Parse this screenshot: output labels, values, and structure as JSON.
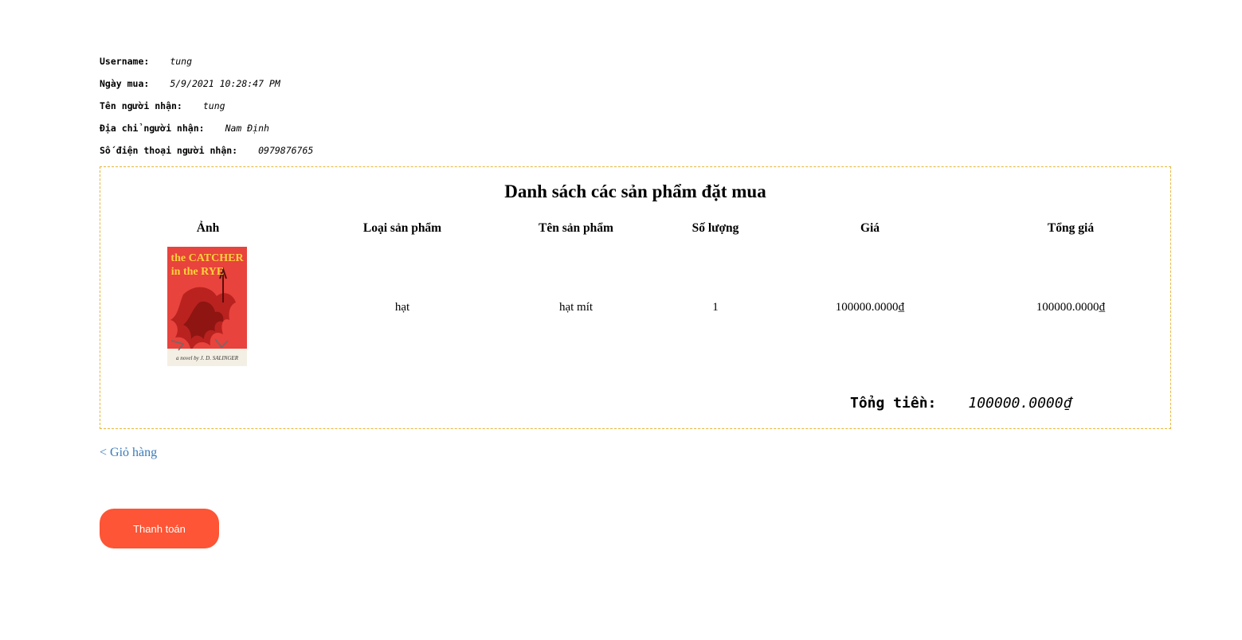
{
  "customer": {
    "username_label": "Username:",
    "username": "tung",
    "date_label": "Ngày mua:",
    "date": "5/9/2021 10:28:47 PM",
    "recipient_label": "Tên người nhận:",
    "recipient": "tung",
    "address_label": "Địa chỉ người nhận:",
    "address": "Nam Định",
    "phone_label": "Số điện thoại người nhận:",
    "phone": "0979876765"
  },
  "order": {
    "title": "Danh sách các sản phẩm đặt mua",
    "columns": [
      "Ảnh",
      "Loại sản phẩm",
      "Tên sản phẩm",
      "Số lượng",
      "Giá",
      "Tổng giá"
    ],
    "rows": [
      {
        "image": {
          "icon": "book-cover-image",
          "title_line1": "the CATCHER",
          "title_line2": "in the RYE",
          "byline": "a novel by J. D. SALINGER"
        },
        "category": "hạt",
        "name": "hạt mít",
        "quantity": "1",
        "price": "100000.0000₫",
        "subtotal": "100000.0000₫"
      }
    ],
    "total_label": "Tổng tiền:",
    "total_value": "100000.0000₫"
  },
  "actions": {
    "back_link": "< Giỏ hàng",
    "pay_button": "Thanh toán"
  },
  "colors": {
    "accent_button": "#fd5535",
    "box_border": "#e8b63a",
    "link": "#3a7ab8",
    "cover_red": "#e8433d",
    "cover_title": "#ffd23a"
  }
}
